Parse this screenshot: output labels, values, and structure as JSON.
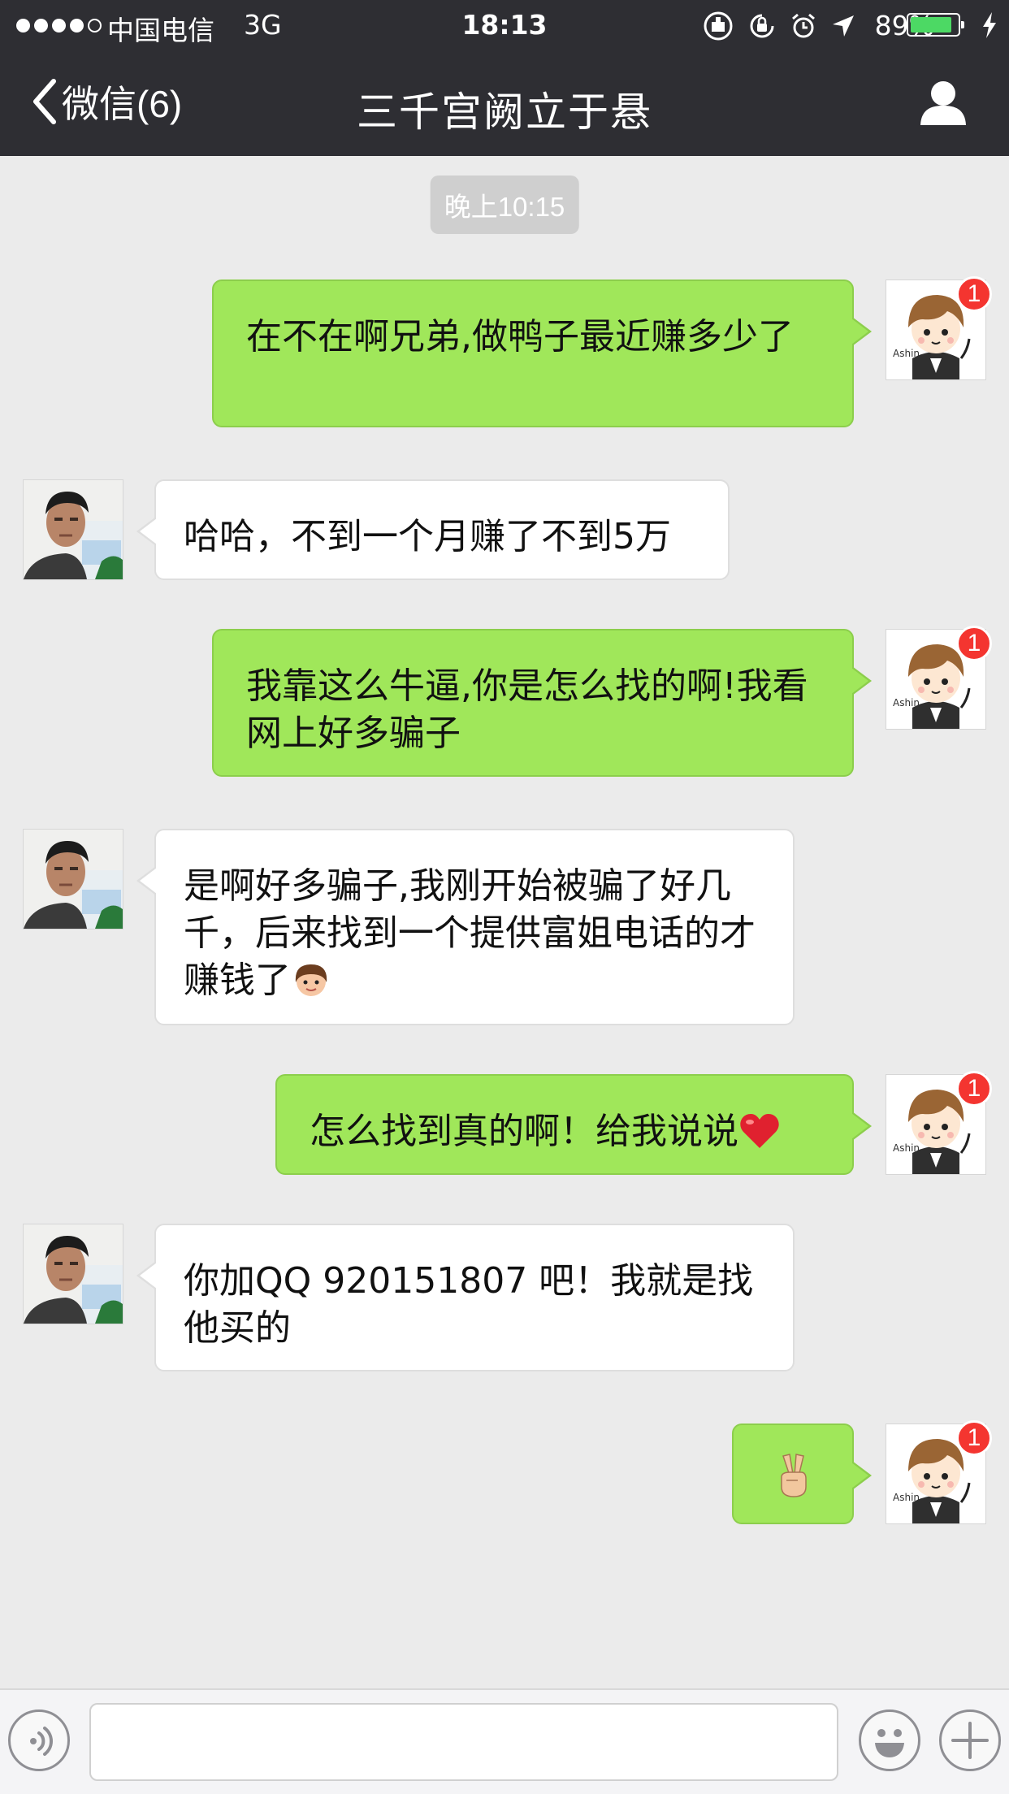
{
  "status_bar": {
    "carrier": "中国电信",
    "network": "3G",
    "time": "18:13",
    "battery_percent": "89%",
    "battery_level": 0.89
  },
  "nav": {
    "back_label": "微信(6)",
    "title": "三千宫阙立于悬"
  },
  "chat": {
    "timestamp": "晚上10:15",
    "messages": [
      {
        "direction": "out",
        "text": "在不在啊兄弟,做鸭子最近赚多少了",
        "badge": "1"
      },
      {
        "direction": "in",
        "text": "哈哈，不到一个月赚了不到5万"
      },
      {
        "direction": "out",
        "text": "我靠这么牛逼,你是怎么找的啊!我看网上好多骗子",
        "badge": "1"
      },
      {
        "direction": "in",
        "text": "是啊好多骗子,我刚开始被骗了好几千，后来找到一个提供富姐电话的才赚钱了",
        "emoji": "girl-face"
      },
      {
        "direction": "out",
        "text": "怎么找到真的啊！给我说说",
        "emoji": "red-heart",
        "badge": "1"
      },
      {
        "direction": "in",
        "text": "你加QQ 920151807 吧！我就是找他买的"
      },
      {
        "direction": "out",
        "text": "",
        "emoji": "victory-hand",
        "badge": "1"
      }
    ]
  },
  "input_bar": {
    "message_value": ""
  },
  "colors": {
    "header_bg": "#2e2e33",
    "chat_bg": "#ebebeb",
    "outgoing_bubble": "#a0e75a",
    "incoming_bubble": "#ffffff",
    "badge": "#f43530",
    "battery_fill": "#4cd964"
  },
  "icons": [
    "back-chevron-icon",
    "profile-icon",
    "voice-icon",
    "emoji-face-icon",
    "plus-icon",
    "alarm-icon",
    "location-arrow-icon",
    "orientation-lock-icon",
    "charging-bolt-icon"
  ]
}
